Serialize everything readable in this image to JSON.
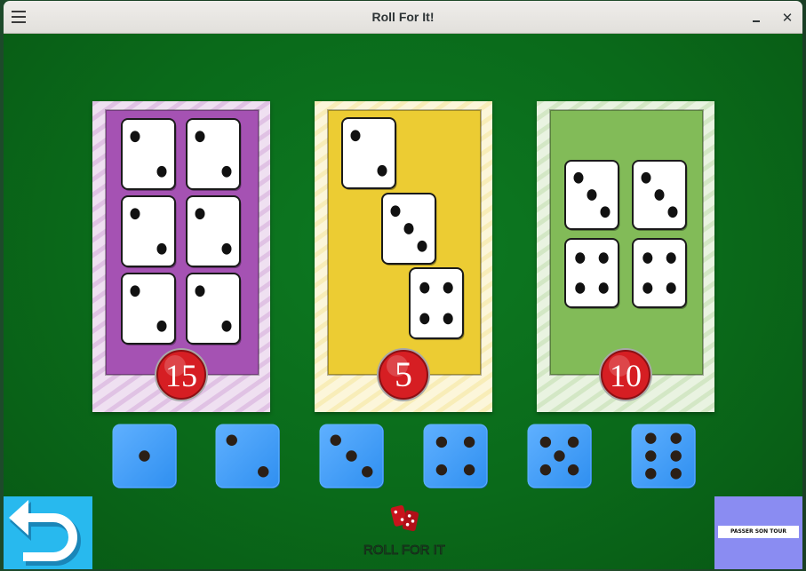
{
  "window": {
    "title": "Roll For It!"
  },
  "titlebar_icons": {
    "menu": "hamburger-icon",
    "minimize": "minimize-icon",
    "close": "close-icon",
    "close_glyph": "✕"
  },
  "cards": [
    {
      "points": "15",
      "color": "#a552b3",
      "dice": [
        2,
        2,
        2,
        2,
        2,
        2
      ]
    },
    {
      "points": "5",
      "color": "#eccc33",
      "dice": [
        2,
        3,
        4
      ]
    },
    {
      "points": "10",
      "color": "#82bb58",
      "dice": [
        3,
        3,
        4,
        4
      ]
    }
  ],
  "roll_dice": [
    1,
    2,
    3,
    4,
    5,
    6
  ],
  "colors": {
    "felt": "#0a6a1a",
    "die_blue": "#2f8ff0",
    "back_button": "#28b9ee",
    "pass_panel": "#8a8cf2",
    "points_badge": "#d61e23"
  },
  "controls": {
    "back_icon": "undo-arrow-icon",
    "pass_turn_label": "PASSER SON TOUR"
  },
  "logo": {
    "icon": "dice-logo-icon",
    "text": "ROLL FOR IT"
  }
}
